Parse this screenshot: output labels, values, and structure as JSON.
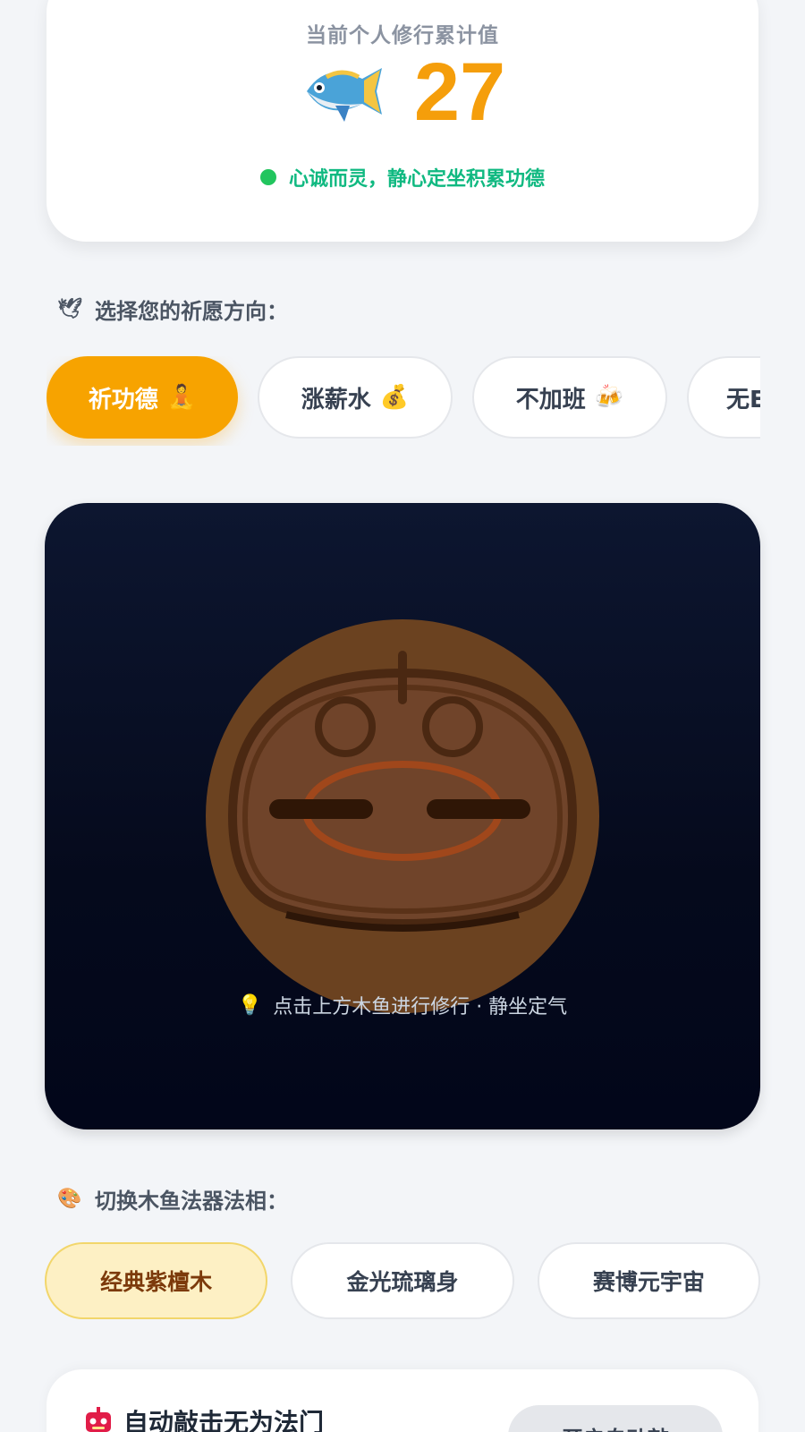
{
  "counter": {
    "title": "当前个人修行累计值",
    "value": "27",
    "status": "心诚而灵，静心定坐积累功德",
    "icon": "fish-icon"
  },
  "wish": {
    "label": "选择您的祈愿方向：",
    "label_icon": "dove-icon",
    "options": [
      {
        "label": "祈功德",
        "emoji": "🧘",
        "active": true
      },
      {
        "label": "涨薪水",
        "emoji": "💰",
        "active": false
      },
      {
        "label": "不加班",
        "emoji": "🍻",
        "active": false
      },
      {
        "label": "无E",
        "emoji": "",
        "active": false
      }
    ]
  },
  "stage": {
    "hint": "点击上方木鱼进行修行 · 静坐定气",
    "hint_icon": "bulb-icon"
  },
  "skin": {
    "label": "切换木鱼法器法相：",
    "label_icon": "palette-icon",
    "options": [
      {
        "label": "经典紫檀木",
        "active": true
      },
      {
        "label": "金光琉璃身",
        "active": false
      },
      {
        "label": "赛博元宇宙",
        "active": false
      }
    ]
  },
  "auto": {
    "title": "自动敲击无为法门",
    "icon": "robot-icon",
    "toggle_label": "开启自动敲"
  },
  "colors": {
    "accent": "#f7a300",
    "counter": "#f59e0b",
    "status": "#10b981",
    "stage_bg": "#050a1c",
    "fish_wood": "#6b4220"
  }
}
